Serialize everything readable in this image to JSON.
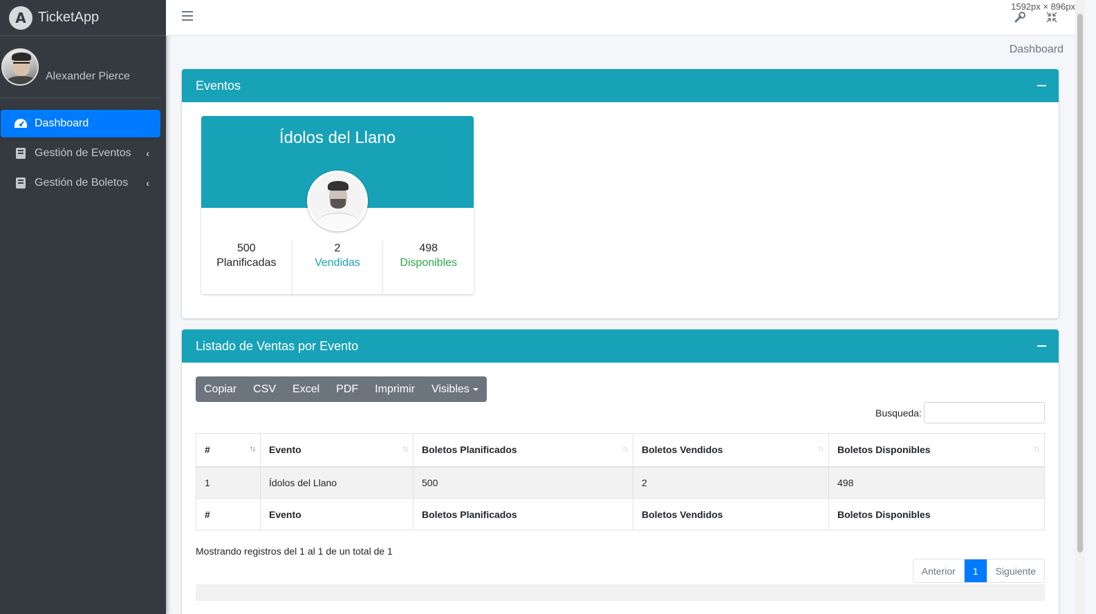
{
  "app": {
    "brand_name": "TicketApp",
    "logo_letter": "A"
  },
  "user": {
    "name": "Alexander Pierce"
  },
  "sidebar": {
    "items": [
      {
        "label": "Dashboard",
        "icon": "tachometer-icon",
        "active": true
      },
      {
        "label": "Gestión de Eventos",
        "icon": "book-icon",
        "chevron": "‹"
      },
      {
        "label": "Gestión de Boletos",
        "icon": "book-icon",
        "chevron": "‹"
      }
    ]
  },
  "topbar": {
    "dimensions": "1592px × 896px"
  },
  "breadcrumb": "Dashboard",
  "events_card": {
    "title": "Eventos",
    "event": {
      "name": "Ídolos del Llano",
      "stats": [
        {
          "value": "500",
          "label": "Planificadas"
        },
        {
          "value": "2",
          "label": "Vendidas"
        },
        {
          "value": "498",
          "label": "Disponibles"
        }
      ]
    }
  },
  "sales_card": {
    "title": "Listado de Ventas por Evento",
    "buttons": [
      "Copiar",
      "CSV",
      "Excel",
      "PDF",
      "Imprimir",
      "Visibles"
    ],
    "search_label": "Busqueda:",
    "table": {
      "headers": [
        "#",
        "Evento",
        "Boletos Planificados",
        "Boletos Vendidos",
        "Boletos Disponibles"
      ],
      "rows": [
        [
          "1",
          "Ídolos del Llano",
          "500",
          "2",
          "498"
        ]
      ]
    },
    "info": "Mostrando registros del 1 al 1 de un total de 1",
    "pagination": {
      "prev": "Anterior",
      "current": "1",
      "next": "Siguiente"
    }
  },
  "colors": {
    "primary": "#007bff",
    "info": "#17a2b8",
    "success": "#28a745",
    "sidebar": "#343a40"
  }
}
